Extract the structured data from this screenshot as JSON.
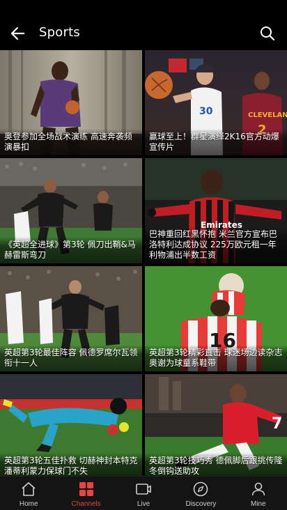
{
  "header": {
    "title": "Sports",
    "back_icon": "back-arrow-icon",
    "search_icon": "search-icon"
  },
  "cards": [
    {
      "caption": "奥登参加全场战术演练 高速奔袭频演暴扣"
    },
    {
      "caption": "赢球至上！群星演绎2K16官方动爆宣传片"
    },
    {
      "caption": "《英超全进球》第3轮 佩刀出鞘&马赫雷斯弯刀"
    },
    {
      "caption": "巴神重回红黑怀抱 米兰官方宣布巴洛特利达成协议 225万欧元租一年利物浦出半数工资"
    },
    {
      "caption": "英超第3轮最佳阵容 佩德罗席尔瓦领衔十一人"
    },
    {
      "caption": "英超第3轮精彩直击 球迷场边读杂志 奥谢为球童系鞋带"
    },
    {
      "caption": "英超第3轮五佳扑救 切赫神封本特克 潘蒂利蒙力保球门不失"
    },
    {
      "caption": "英超第3轮技巧秀 德佩脚后跟挑传隆冬倒钩送助攻"
    }
  ],
  "nav": [
    {
      "label": "Home",
      "icon": "home-icon"
    },
    {
      "label": "Channels",
      "icon": "channels-icon"
    },
    {
      "label": "Live",
      "icon": "live-tv-icon"
    },
    {
      "label": "Discovery",
      "icon": "compass-icon"
    },
    {
      "label": "Mine",
      "icon": "person-icon"
    }
  ],
  "colors": {
    "accent": "#e8463a",
    "background": "#000000",
    "nav_background": "#141414"
  }
}
